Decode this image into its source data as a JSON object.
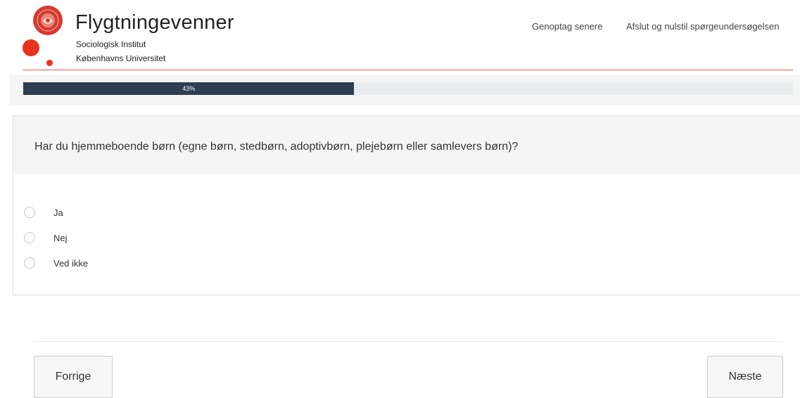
{
  "brand": {
    "title": "Flygtningevenner",
    "subtitle_line1": "Sociologisk Institut",
    "subtitle_line2": "Københavns Universitet",
    "accent_color": "#e8321f"
  },
  "top_nav": {
    "resume_later": "Genoptag senere",
    "exit_reset": "Afslut og nulstil spørgeundersøgelsen"
  },
  "progress": {
    "percent": 43,
    "label": "43%"
  },
  "question": {
    "text": "Har du hjemmeboende børn (egne børn, stedbørn, adoptivbørn, plejebørn eller samlevers børn)?",
    "options": [
      {
        "label": "Ja",
        "selected": false
      },
      {
        "label": "Nej",
        "selected": false
      },
      {
        "label": "Ved ikke",
        "selected": false
      }
    ]
  },
  "navigation": {
    "previous": "Forrige",
    "next": "Næste"
  }
}
